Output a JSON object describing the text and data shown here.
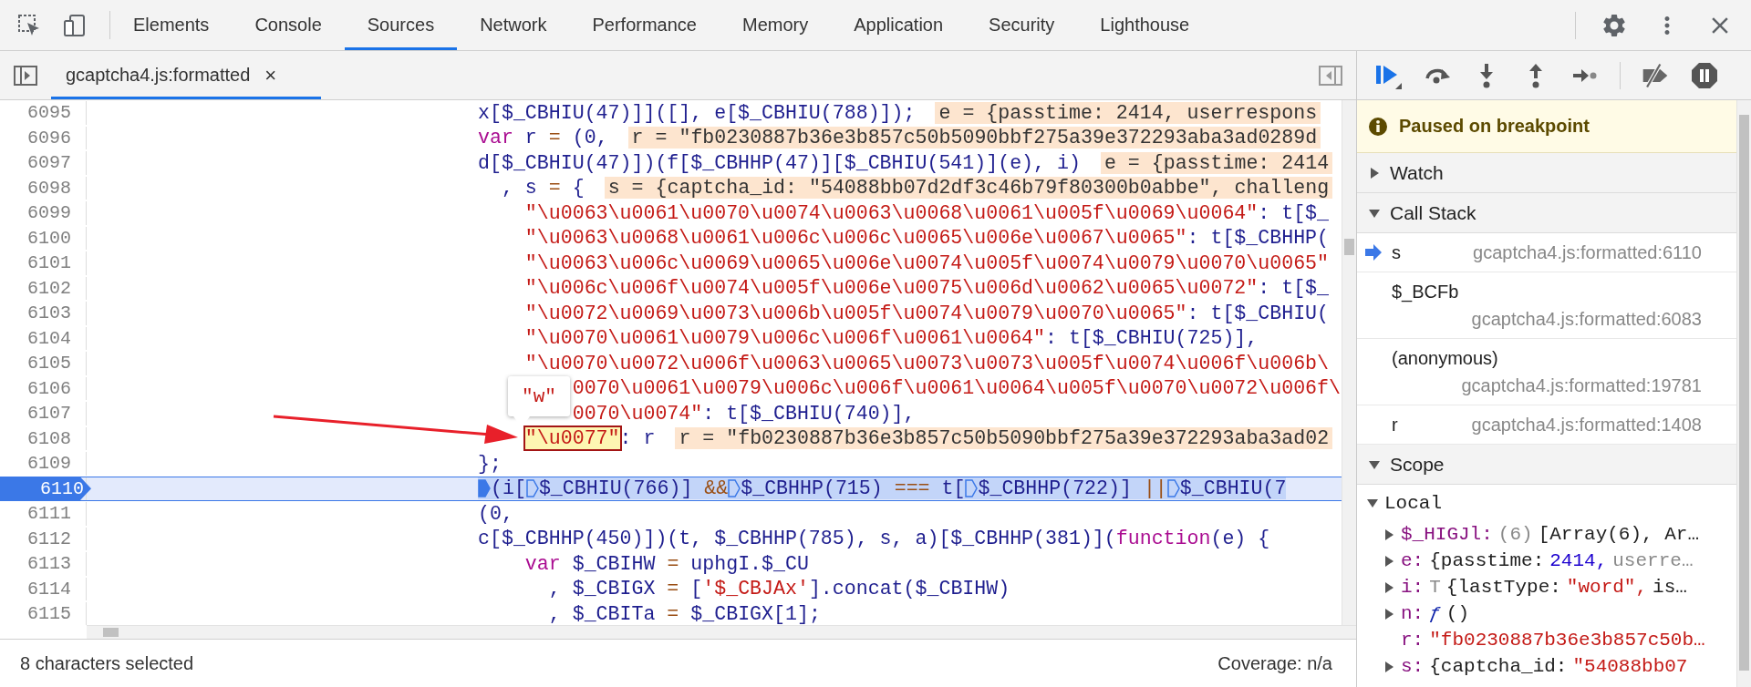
{
  "top_bar": {
    "tabs": [
      {
        "label": "Elements",
        "selected": false
      },
      {
        "label": "Console",
        "selected": false
      },
      {
        "label": "Sources",
        "selected": true
      },
      {
        "label": "Network",
        "selected": false
      },
      {
        "label": "Performance",
        "selected": false
      },
      {
        "label": "Memory",
        "selected": false
      },
      {
        "label": "Application",
        "selected": false
      },
      {
        "label": "Security",
        "selected": false
      },
      {
        "label": "Lighthouse",
        "selected": false
      }
    ]
  },
  "file_tab": {
    "title": "gcaptcha4.js:formatted",
    "close": "×"
  },
  "editor": {
    "tooltip": "\"w\"",
    "lines": [
      {
        "number": "6095",
        "current": false,
        "segments": [
          {
            "kind": "code",
            "text": "x[$_CBHIU(47)]]([], e[$_CBHIU(788)]);"
          },
          {
            "kind": "value",
            "text": "e = {passtime: 2414, userrespons"
          }
        ]
      },
      {
        "number": "6096",
        "current": false,
        "segments": [
          {
            "kind": "kw",
            "text": "var"
          },
          {
            "kind": "code",
            "text": " r "
          },
          {
            "kind": "op",
            "text": "="
          },
          {
            "kind": "code",
            "text": " (0,"
          },
          {
            "kind": "value",
            "text": "r = \"fb0230887b36e3b857c50b5090bbf275a39e372293aba3ad0289d"
          }
        ]
      },
      {
        "number": "6097",
        "current": false,
        "segments": [
          {
            "kind": "code",
            "text": "d[$_CBHIU(47)])(f[$_CBHHP(47)][$_CBHIU(541)](e), i)"
          },
          {
            "kind": "value",
            "text": "e = {passtime: 2414"
          }
        ]
      },
      {
        "number": "6098",
        "current": false,
        "segments": [
          {
            "kind": "code",
            "text": "  , s "
          },
          {
            "kind": "op",
            "text": "="
          },
          {
            "kind": "code",
            "text": " {"
          },
          {
            "kind": "value",
            "text": "s = {captcha_id: \"54088bb07d2df3c46b79f80300b0abbe\", challeng"
          }
        ]
      },
      {
        "number": "6099",
        "current": false,
        "segments": [
          {
            "kind": "str",
            "text": "    \"\\u0063\\u0061\\u0070\\u0074\\u0063\\u0068\\u0061\\u005f\\u0069\\u0064\""
          },
          {
            "kind": "code",
            "text": ": t[$_"
          }
        ]
      },
      {
        "number": "6100",
        "current": false,
        "segments": [
          {
            "kind": "str",
            "text": "    \"\\u0063\\u0068\\u0061\\u006c\\u006c\\u0065\\u006e\\u0067\\u0065\""
          },
          {
            "kind": "code",
            "text": ": t[$_CBHHP("
          }
        ]
      },
      {
        "number": "6101",
        "current": false,
        "segments": [
          {
            "kind": "str",
            "text": "    \"\\u0063\\u006c\\u0069\\u0065\\u006e\\u0074\\u005f\\u0074\\u0079\\u0070\\u0065\""
          }
        ]
      },
      {
        "number": "6102",
        "current": false,
        "segments": [
          {
            "kind": "str",
            "text": "    \"\\u006c\\u006f\\u0074\\u005f\\u006e\\u0075\\u006d\\u0062\\u0065\\u0072\""
          },
          {
            "kind": "code",
            "text": ": t[$_"
          }
        ]
      },
      {
        "number": "6103",
        "current": false,
        "segments": [
          {
            "kind": "str",
            "text": "    \"\\u0072\\u0069\\u0073\\u006b\\u005f\\u0074\\u0079\\u0070\\u0065\""
          },
          {
            "kind": "code",
            "text": ": t[$_CBHIU("
          }
        ]
      },
      {
        "number": "6104",
        "current": false,
        "segments": [
          {
            "kind": "str",
            "text": "    \"\\u0070\\u0061\\u0079\\u006c\\u006f\\u0061\\u0064\""
          },
          {
            "kind": "code",
            "text": ": t[$_CBHIU(725)],"
          }
        ]
      },
      {
        "number": "6105",
        "current": false,
        "segments": [
          {
            "kind": "str",
            "text": "    \"\\u0070\\u0072\\u006f\\u0063\\u0065\\u0073\\u0073\\u005f\\u0074\\u006f\\u006b\\"
          }
        ]
      },
      {
        "number": "6106",
        "current": false,
        "segments": [
          {
            "kind": "str",
            "text": "        0070\\u0061\\u0079\\u006c\\u006f\\u0061\\u0064\\u005f\\u0070\\u0072\\u006f\\"
          }
        ]
      },
      {
        "number": "6107",
        "current": false,
        "segments": [
          {
            "kind": "str",
            "text": "        0070\\u0074\""
          },
          {
            "kind": "code",
            "text": ": t[$_CBHIU(740)],"
          }
        ]
      },
      {
        "number": "6108",
        "current": false,
        "segments": [
          {
            "kind": "match",
            "text": "    \"\\u0077\""
          },
          {
            "kind": "code",
            "text": ": r"
          },
          {
            "kind": "value",
            "text": "r = \"fb0230887b36e3b857c50b5090bbf275a39e372293aba3ad02"
          }
        ]
      },
      {
        "number": "6109",
        "current": false,
        "segments": [
          {
            "kind": "code",
            "text": "};"
          }
        ]
      },
      {
        "number": "6110",
        "current": true,
        "segments": [
          {
            "kind": "bp_on"
          },
          {
            "kind": "code",
            "text": "(i["
          },
          {
            "kind": "bp"
          },
          {
            "kind": "code",
            "text": "$_CBHIU(766)] "
          },
          {
            "kind": "op",
            "text": "&&"
          },
          {
            "kind": "bp"
          },
          {
            "kind": "code",
            "text": "$_CBHHP(715) "
          },
          {
            "kind": "op",
            "text": "==="
          },
          {
            "kind": "code",
            "text": " t["
          },
          {
            "kind": "bp"
          },
          {
            "kind": "code",
            "text": "$_CBHHP(722)] "
          },
          {
            "kind": "op",
            "text": "||"
          },
          {
            "kind": "bp"
          },
          {
            "kind": "code",
            "text": "$_CBHIU(7"
          }
        ]
      },
      {
        "number": "6111",
        "current": false,
        "segments": [
          {
            "kind": "code",
            "text": "(0,"
          }
        ]
      },
      {
        "number": "6112",
        "current": false,
        "segments": [
          {
            "kind": "code",
            "text": "c[$_CBHHP(450)])(t, $_CBHHP(785), s, a)[$_CBHHP(381)]("
          },
          {
            "kind": "kw",
            "text": "function"
          },
          {
            "kind": "code",
            "text": "(e) {"
          }
        ]
      },
      {
        "number": "6113",
        "current": false,
        "segments": [
          {
            "kind": "kw",
            "text": "    var"
          },
          {
            "kind": "code",
            "text": " $_CBIHW "
          },
          {
            "kind": "op",
            "text": "="
          },
          {
            "kind": "code",
            "text": " uphgI.$_CU"
          }
        ]
      },
      {
        "number": "6114",
        "current": false,
        "segments": [
          {
            "kind": "code",
            "text": "      , $_CBIGX "
          },
          {
            "kind": "op",
            "text": "="
          },
          {
            "kind": "code",
            "text": " ["
          },
          {
            "kind": "str",
            "text": "'$_CBJAx'"
          },
          {
            "kind": "code",
            "text": "].concat($_CBIHW)"
          }
        ]
      },
      {
        "number": "6115",
        "current": false,
        "segments": [
          {
            "kind": "code",
            "text": "      , $_CBITa "
          },
          {
            "kind": "op",
            "text": "="
          },
          {
            "kind": "code",
            "text": " $_CBIGX[1];"
          }
        ]
      }
    ]
  },
  "status_bar": {
    "selection": "8 characters selected",
    "coverage": "Coverage: n/a"
  },
  "debugger": {
    "banner": "Paused on breakpoint",
    "watch": {
      "label": "Watch",
      "expanded": false
    },
    "call_stack": {
      "label": "Call Stack",
      "expanded": true,
      "frames": [
        {
          "name": "s",
          "location": "gcaptcha4.js:formatted:6110",
          "selected": true
        },
        {
          "name": "$_BCFb",
          "location": "gcaptcha4.js:formatted:6083",
          "selected": false
        },
        {
          "name": "(anonymous)",
          "location": "gcaptcha4.js:formatted:19781",
          "selected": false
        },
        {
          "name": "r",
          "location": "gcaptcha4.js:formatted:1408",
          "selected": false
        }
      ]
    },
    "scope": {
      "label": "Scope",
      "expanded": true,
      "groups": [
        {
          "label": "Local",
          "expanded": true,
          "entries": [
            {
              "name": "$_HIGJl:",
              "expandable": true,
              "value": [
                {
                  "kind": "dim",
                  "text": "(6)"
                },
                {
                  "kind": "plain",
                  "text": "[Array(6), Ar…"
                }
              ]
            },
            {
              "name": "e:",
              "expandable": true,
              "value": [
                {
                  "kind": "plain",
                  "text": "{passtime:"
                },
                {
                  "kind": "num",
                  "text": "2414,"
                },
                {
                  "kind": "dim",
                  "text": "userre…"
                }
              ]
            },
            {
              "name": "i:",
              "expandable": true,
              "value": [
                {
                  "kind": "dim",
                  "text": "T"
                },
                {
                  "kind": "plain",
                  "text": "{lastType:"
                },
                {
                  "kind": "str",
                  "text": "\"word\","
                },
                {
                  "kind": "plain",
                  "text": "is…"
                }
              ]
            },
            {
              "name": "n:",
              "expandable": true,
              "value": [
                {
                  "kind": "fn",
                  "text": "ƒ"
                },
                {
                  "kind": "plain",
                  "text": "()"
                }
              ]
            },
            {
              "name": "r:",
              "expandable": false,
              "value": [
                {
                  "kind": "str",
                  "text": "\"fb0230887b36e3b857c50b…"
                }
              ]
            },
            {
              "name": "s:",
              "expandable": true,
              "value": [
                {
                  "kind": "plain",
                  "text": "{captcha_id:"
                },
                {
                  "kind": "str",
                  "text": "\"54088bb07"
                }
              ]
            }
          ]
        }
      ]
    }
  }
}
